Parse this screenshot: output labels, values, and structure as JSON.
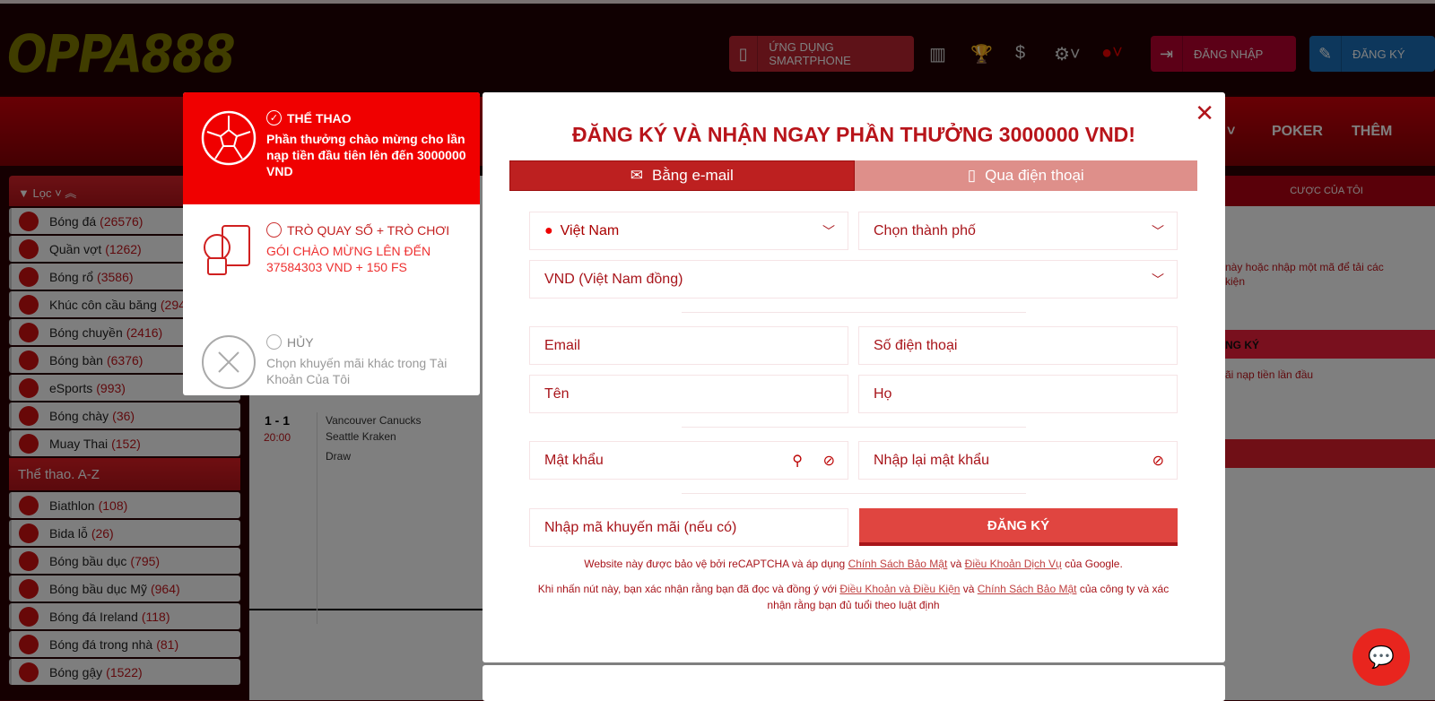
{
  "header": {
    "logo": "OPPA888",
    "smartphone_label": "ỨNG DỤNG SMARTPHONE",
    "login_label": "ĐĂNG NHẬP",
    "register_label": "ĐĂNG KÝ"
  },
  "nav": {
    "poker": "POKER",
    "more": "THÊM"
  },
  "sidebar": {
    "filter": "Lọc",
    "items": [
      {
        "name": "Bóng đá",
        "count": "(26576)"
      },
      {
        "name": "Quần vợt",
        "count": "(1262)"
      },
      {
        "name": "Bóng rổ",
        "count": "(3586)"
      },
      {
        "name": "Khúc côn cầu băng",
        "count": "(294"
      },
      {
        "name": "Bóng chuyền",
        "count": "(2416)"
      },
      {
        "name": "Bóng bàn",
        "count": "(6376)"
      },
      {
        "name": "eSports",
        "count": "(993)"
      },
      {
        "name": "Bóng chày",
        "count": "(36)"
      },
      {
        "name": "Muay Thai",
        "count": "(152)"
      }
    ],
    "az_title": "Thể thao. A-Z",
    "az_items": [
      {
        "name": "Biathlon",
        "count": "(108)"
      },
      {
        "name": "Bida lỗ",
        "count": "(26)"
      },
      {
        "name": "Bóng bầu dục",
        "count": "(795)"
      },
      {
        "name": "Bóng bầu dục Mỹ",
        "count": "(964)"
      },
      {
        "name": "Bóng đá Ireland",
        "count": "(118)"
      },
      {
        "name": "Bóng đá trong nhà",
        "count": "(81)"
      },
      {
        "name": "Bóng gậy",
        "count": "(1522)"
      }
    ]
  },
  "match": {
    "score": "1 - 1",
    "time": "20:00",
    "team1": "Vancouver Canucks",
    "team2": "Seattle Kraken",
    "draw": "Draw"
  },
  "right_panel": {
    "tab": "CƯỢC CỦA TÔI",
    "text1": "này hoặc nhập một mã để tải các",
    "text2": "kiện",
    "reg": "NG KÝ",
    "promo": "ãi nạp tiền lần đầu"
  },
  "promo": [
    {
      "title": "THỂ THAO",
      "desc": "Phần thưởng chào mừng cho lần nạp tiền đầu tiên lên đến 3000000 VND",
      "selected": true,
      "icon": "soccer-ball-icon"
    },
    {
      "title": "TRÒ QUAY SỐ + TRÒ CHƠI",
      "desc": "GÓI CHÀO MỪNG LÊN ĐẾN 37584303 VND + 150 FS",
      "selected": false,
      "icon": "casino-icon"
    },
    {
      "title": "HỦY",
      "desc": "Chọn khuyến mãi khác trong Tài Khoản Của Tôi",
      "selected": false,
      "icon": "cancel-icon"
    }
  ],
  "modal": {
    "title": "ĐĂNG KÝ VÀ NHẬN NGAY PHẦN THƯỞNG 3000000 VND!",
    "tab_email": "Bằng e-mail",
    "tab_phone": "Qua điện thoại",
    "country": "Việt Nam",
    "city": "Chọn thành phố",
    "currency": "VND (Việt Nam đồng)",
    "email": "Email",
    "phone": "Số điện thoại",
    "first_name": "Tên",
    "last_name": "Họ",
    "password": "Mật khẩu",
    "password_confirm": "Nhập lại mật khẩu",
    "promo_code": "Nhập mã khuyến mãi (nếu có)",
    "submit": "ĐĂNG KÝ",
    "legal1_a": "Website này được bảo vệ bởi reCAPTCHA và áp dụng ",
    "legal1_link1": "Chính Sách Bảo Mật",
    "legal1_b": " và ",
    "legal1_link2": "Điều Khoản Dịch Vụ",
    "legal1_c": " của Google.",
    "legal2_a": "Khi nhấn nút này, bạn xác nhận rằng bạn đã đọc và đồng ý với ",
    "legal2_link1": "Điều Khoản và Điều Kiện",
    "legal2_b": " và ",
    "legal2_link2": "Chính Sách Bảo Mật",
    "legal2_c": " của công ty và xác nhận rằng bạn đủ tuổi theo luật định"
  },
  "colors": {
    "brand_red": "#b8141a",
    "header_bg": "#200003",
    "logo": "#807a00",
    "login": "#b8002e",
    "register": "#1a6fb8"
  }
}
